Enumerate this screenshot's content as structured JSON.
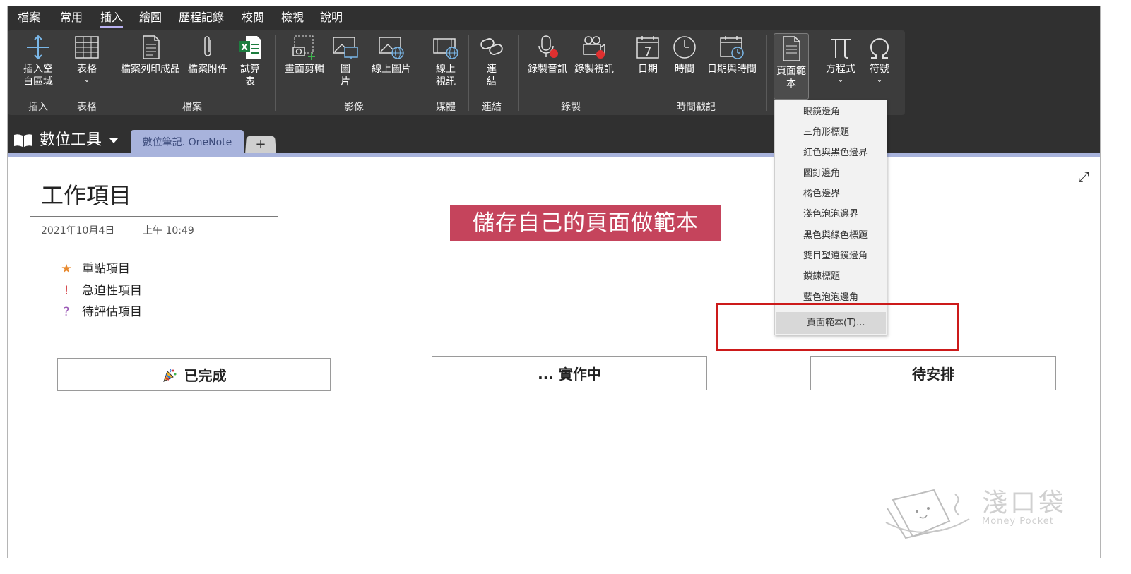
{
  "menu": [
    "檔案",
    "常用",
    "插入",
    "繪圖",
    "歷程記錄",
    "校閱",
    "檢視",
    "說明"
  ],
  "ribbon": {
    "buttons": {
      "insert_space": "插入空\n白區域",
      "table": "表格",
      "file_printout": "檔案列印成品",
      "file_attachment": "檔案附件",
      "spreadsheet": "試算\n表",
      "screen_clipping": "畫面剪輯",
      "picture": "圖\n片",
      "online_picture": "線上圖片",
      "online_video": "線上\n視訊",
      "link": "連\n結",
      "record_audio": "錄製音訊",
      "record_video": "錄製視訊",
      "date": "日期",
      "time": "時間",
      "date_time": "日期與時間",
      "page_templates": "頁面範\n本",
      "equation": "方程式",
      "symbol": "符號"
    },
    "groups": {
      "insert": "插入",
      "tables": "表格",
      "files": "檔案",
      "images": "影像",
      "media": "媒體",
      "links": "連結",
      "recording": "錄製",
      "time_stamp": "時間戳記"
    }
  },
  "notebook": {
    "name": "數位工具",
    "active_tab": "數位筆記. OneNote",
    "add_tab": "+"
  },
  "page": {
    "title": "工作項目",
    "date": "2021年10月4日",
    "time": "上午 10:49",
    "tags": [
      {
        "icon": "★",
        "label": "重點項目",
        "color": "#e8892e"
      },
      {
        "icon": "!",
        "label": "急迫性項目",
        "color": "#d13438"
      },
      {
        "icon": "?",
        "label": "待評估項目",
        "color": "#9b59b6"
      }
    ],
    "banner": "儲存自己的頁面做範本",
    "columns": {
      "done": "已完成",
      "in_progress": "... 實作中",
      "todo": "待安排"
    }
  },
  "template_menu": {
    "items": [
      "眼鏡邊角",
      "三角形標題",
      "紅色與黑色邊界",
      "圖釘邊角",
      "橘色邊界",
      "淺色泡泡邊界",
      "黑色與綠色標題",
      "雙目望遠鏡邊角",
      "鎖鍊標題",
      "藍色泡泡邊角"
    ],
    "last": "頁面範本(T)..."
  },
  "watermark": {
    "title": "淺口袋",
    "subtitle": "Money Pocket"
  }
}
